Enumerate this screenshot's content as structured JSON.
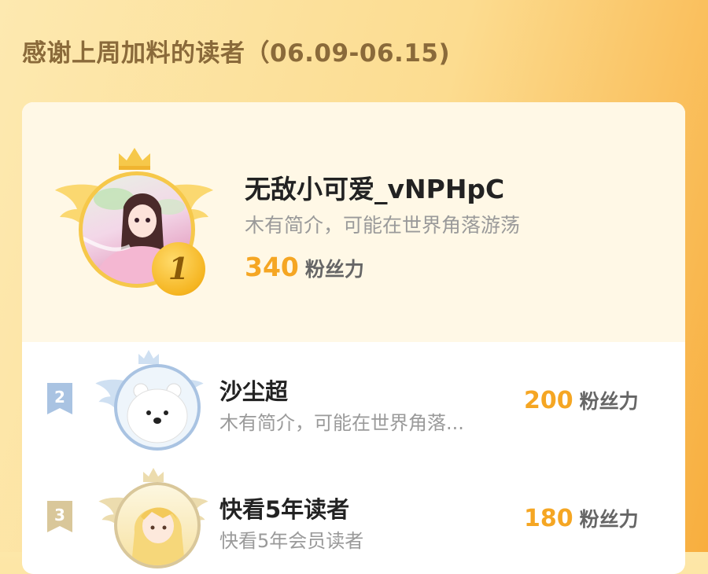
{
  "title": "感谢上周加料的读者（06.09-06.15)",
  "top_reader": {
    "rank": "1",
    "name": "无敌小可爱_vNPHpC",
    "bio": "木有简介，可能在世界角落游荡",
    "score": "340",
    "score_unit": "粉丝力",
    "avatar_icon": "anime-girl-avatar"
  },
  "readers": [
    {
      "rank": "2",
      "name": "沙尘超",
      "bio": "木有简介，可能在世界角落...",
      "score": "200",
      "score_unit": "粉丝力",
      "avatar_icon": "polar-bear-avatar",
      "rank_color": "#a9c3e2"
    },
    {
      "rank": "3",
      "name": "快看5年读者",
      "bio": "快看5年会员读者",
      "score": "180",
      "score_unit": "粉丝力",
      "avatar_icon": "blonde-girl-avatar",
      "rank_color": "#d9c79a"
    }
  ],
  "colors": {
    "score": "#f5a623",
    "title": "#8a6a3a",
    "gold": "#f5b521"
  }
}
